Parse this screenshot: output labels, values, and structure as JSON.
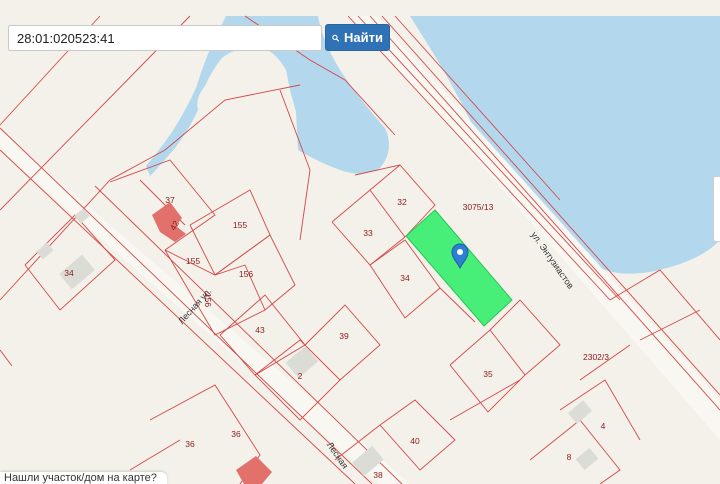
{
  "search": {
    "value": "28:01:020523:41",
    "button_label": "Найти"
  },
  "map": {
    "streets": [
      "ул. Энтузиастов",
      "Лесная ул.",
      "Лесная"
    ],
    "plots": [
      "32",
      "33",
      "34",
      "35",
      "36",
      "36",
      "37",
      "38",
      "39",
      "40",
      "43",
      "155",
      "155",
      "156",
      "156",
      "2",
      "4",
      "8",
      "34",
      "42",
      "3075/13",
      "2302/3"
    ],
    "colors": {
      "water": "#b3d8ee",
      "boundary": "#d44848",
      "selected": "#47ef78",
      "marker": "#2d7fd3"
    },
    "icons": {
      "marker": "map-pin-icon",
      "search": "search-icon"
    }
  },
  "bottom_hint": "Нашли участок/дом на карте?"
}
